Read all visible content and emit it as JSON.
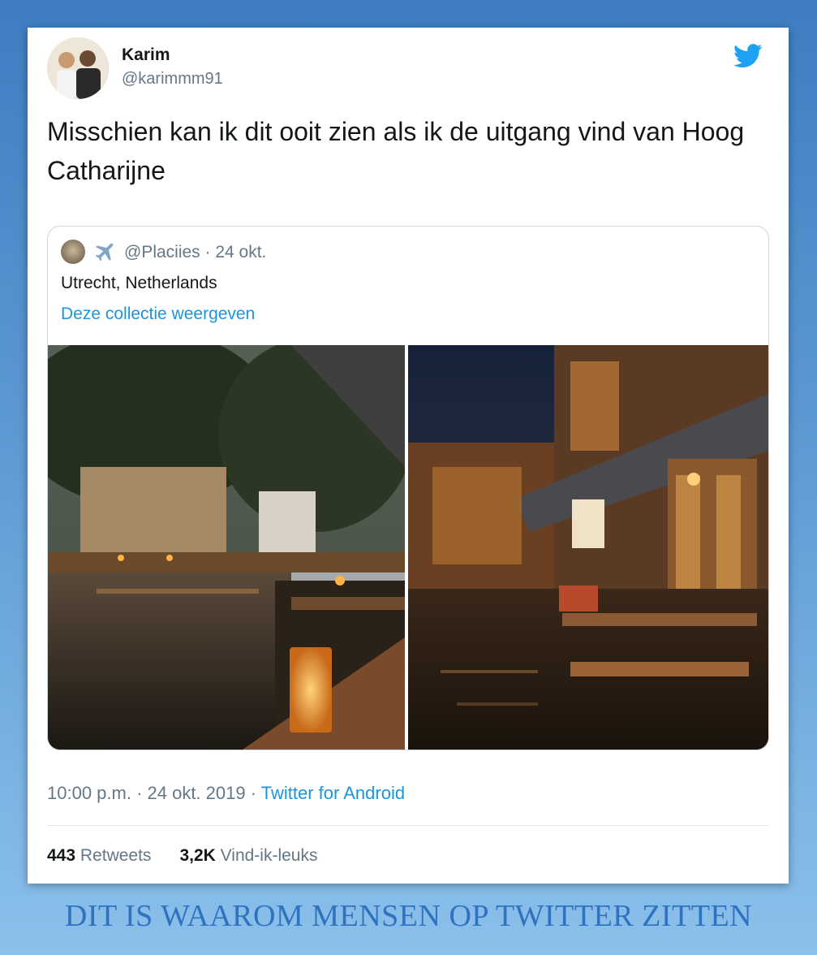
{
  "tweet": {
    "author_name": "Karim",
    "author_handle": "@karimmm91",
    "text": "Misschien kan ik dit ooit zien als ik de uitgang vind van Hoog Catharijne",
    "timestamp": "10:00 p.m. · 24 okt. 2019 · ",
    "source": "Twitter for Android",
    "retweets_count": "443",
    "retweets_label": "Retweets",
    "likes_count": "3,2K",
    "likes_label": "Vind-ik-leuks",
    "bird_icon": "twitter-bird-icon"
  },
  "quoted_tweet": {
    "handle_and_date": "@Placiies · 24 okt.",
    "location": "Utrecht, Netherlands",
    "link_text": "Deze collectie weergeven",
    "icons": [
      "avatar",
      "airplane-icon"
    ],
    "photos": [
      "canal-terrace-photo",
      "street-terrace-photo"
    ]
  },
  "banner": {
    "text": "DIT IS WAAROM MENSEN OP TWITTER ZITTEN"
  },
  "colors": {
    "link": "#1b95e0",
    "muted": "#657786",
    "text": "#14171a",
    "banner": "#2f73c0"
  }
}
